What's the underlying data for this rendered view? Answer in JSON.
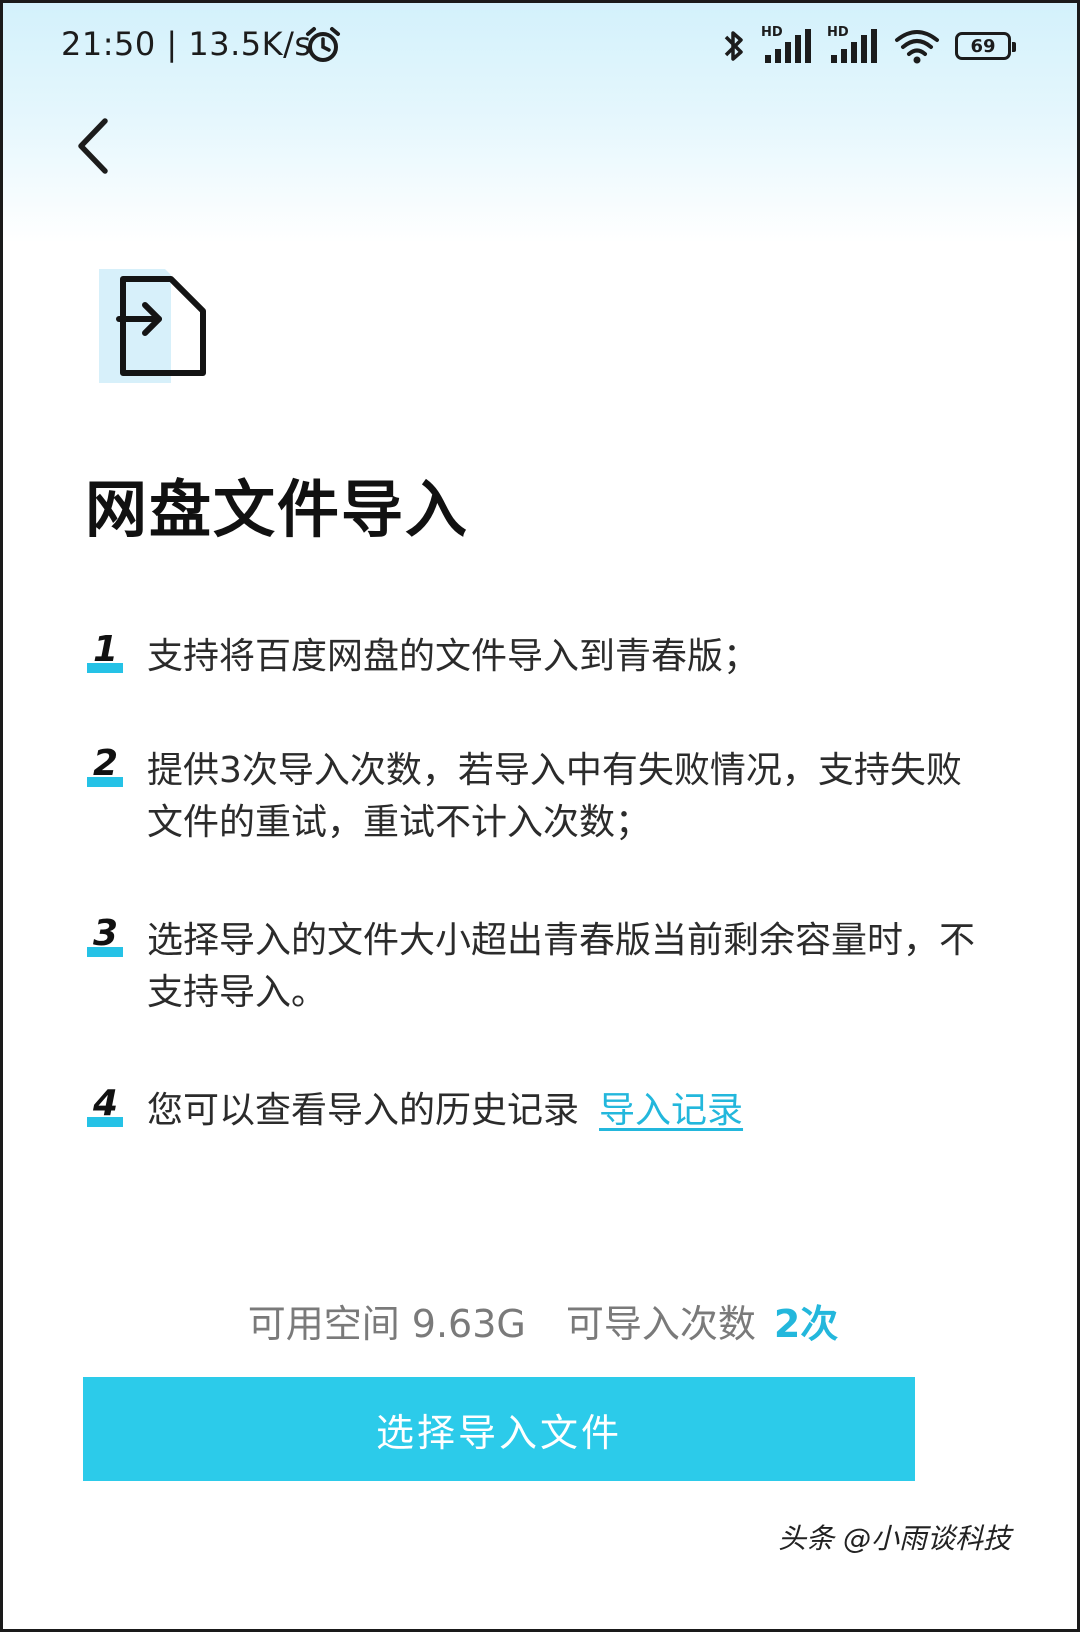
{
  "status_bar": {
    "time": "21:50",
    "separator": "|",
    "net_speed": "13.5K/s",
    "signal_label_1": "HD",
    "signal_label_2": "HD",
    "battery": "69"
  },
  "header": {
    "back_icon": "chevron-left-icon"
  },
  "hero": {
    "icon": "file-import-icon",
    "accent": "#bfe7f6"
  },
  "page_title": "网盘文件导入",
  "rules": [
    {
      "num": "1",
      "text": "支持将百度网盘的文件导入到青春版；"
    },
    {
      "num": "2",
      "text": "提供3次导入次数，若导入中有失败情况，支持失败文件的重试，重试不计入次数；"
    },
    {
      "num": "3",
      "text": "选择导入的文件大小超出青春版当前剩余容量时，不支持导入。"
    },
    {
      "num": "4",
      "text": "您可以查看导入的历史记录",
      "link": "导入记录"
    }
  ],
  "quota": {
    "space_label": "可用空间 9.63G",
    "count_label": "可导入次数",
    "count_value": "2次"
  },
  "primary_button": {
    "label": "选择导入文件"
  },
  "watermark": "头条 @小雨谈科技",
  "colors": {
    "accent": "#2ccbea",
    "link": "#23b7dc",
    "text": "#2b2b2b",
    "muted": "#7a7a7a"
  }
}
